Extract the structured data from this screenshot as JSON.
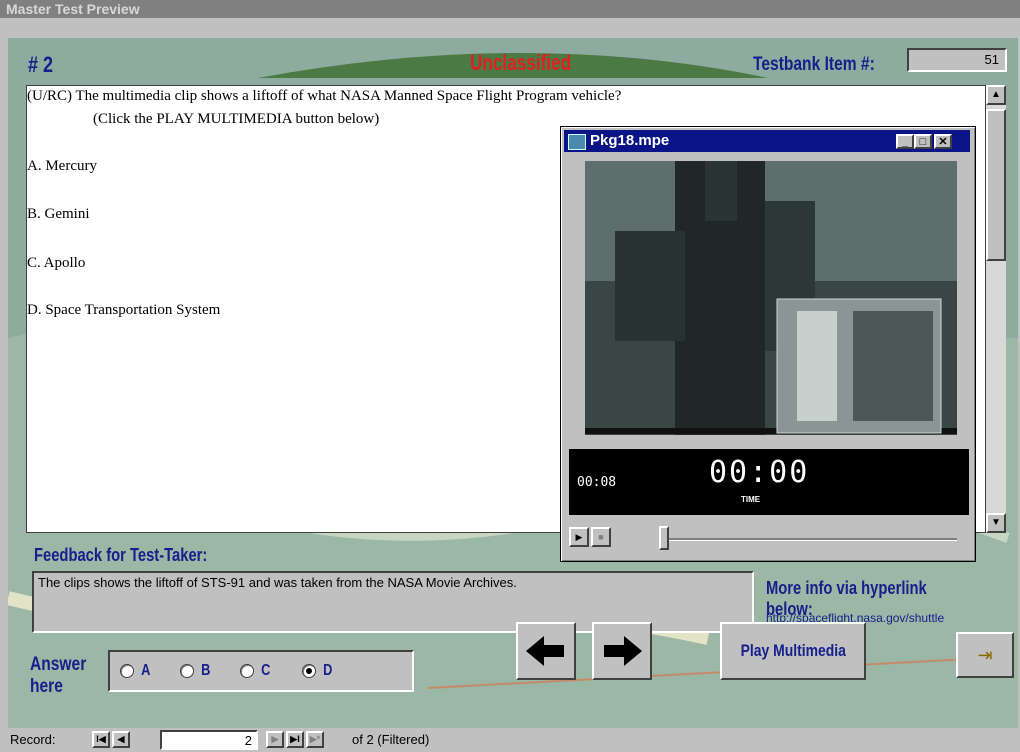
{
  "window": {
    "title": "Master Test Preview"
  },
  "header": {
    "question_number": "# 2",
    "classification": "Unclassified",
    "testbank_label": "Testbank Item #:",
    "testbank_value": "51"
  },
  "question": {
    "stem_line1": "(U/RC)  The multimedia clip shows a liftoff of what NASA Manned Space Flight Program vehicle?",
    "stem_line2": "(Click the PLAY MULTIMEDIA button below)",
    "options": [
      "A.  Mercury",
      "B.  Gemini",
      "C.  Apollo",
      "D.  Space Transportation System"
    ]
  },
  "media_player": {
    "title": "Pkg18.mpe",
    "elapsed": "00:08",
    "clock": "00:00",
    "clock_label": "TIME",
    "progress": 0
  },
  "feedback": {
    "label": "Feedback for Test-Taker:",
    "text": "The clips shows the liftoff of STS-91 and was taken from the NASA Movie Archives."
  },
  "more_info": {
    "label": "More info via hyperlink below:",
    "url": "http://spaceflight.nasa.gov/shuttle"
  },
  "answer": {
    "label_line1": "Answer",
    "label_line2": "here",
    "options": [
      "A",
      "B",
      "C",
      "D"
    ],
    "selected": "D"
  },
  "buttons": {
    "play_multimedia": "Play Multimedia"
  },
  "record_nav": {
    "label": "Record:",
    "current": "2",
    "of_text": "of  2 (Filtered)"
  },
  "colors": {
    "heading_blue": "#17208a",
    "classification_red": "#e02020",
    "titlebar_blue": "#0a1486"
  }
}
